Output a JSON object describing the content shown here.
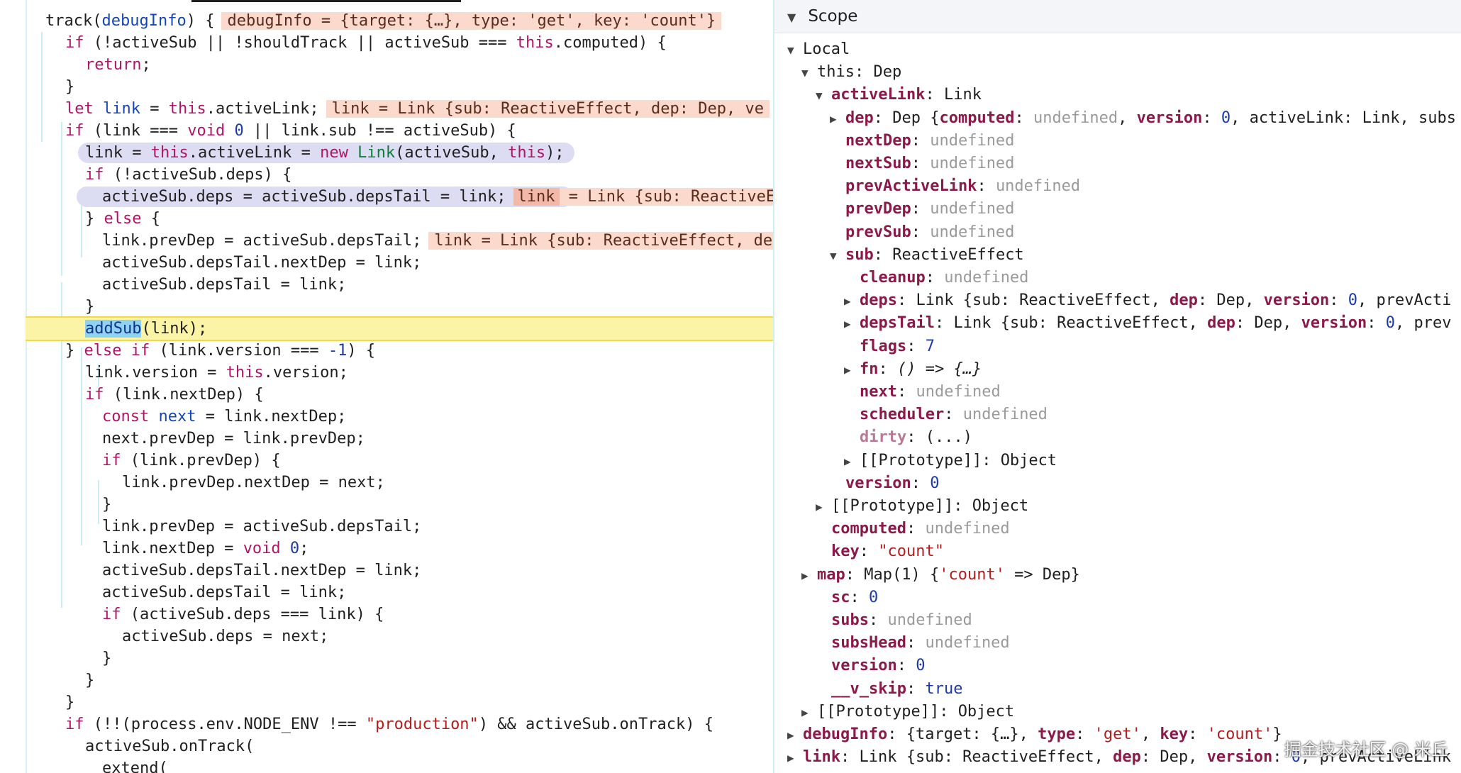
{
  "code": {
    "lines": [
      {
        "id": "l1",
        "segs": [
          [
            "track(",
            ""
          ],
          [
            "debugInfo",
            "fn-name"
          ],
          [
            ") {",
            ""
          ]
        ],
        "inline": "debugInfo = {target: {…}, type: 'get', key: 'count'}"
      },
      {
        "id": "l2",
        "segs": [
          [
            "if",
            "kw"
          ],
          [
            " (!activeSub || !shouldTrack || activeSub === ",
            ""
          ],
          [
            "this",
            "kw"
          ],
          [
            ".computed) {",
            ""
          ]
        ]
      },
      {
        "id": "l3",
        "segs": [
          [
            "return",
            "kw"
          ],
          [
            ";",
            ""
          ]
        ]
      },
      {
        "id": "l4",
        "segs": [
          [
            "}",
            ""
          ]
        ]
      },
      {
        "id": "l5",
        "segs": [
          [
            "let",
            "kw"
          ],
          [
            " ",
            ""
          ],
          [
            "link",
            "fn-name"
          ],
          [
            " = ",
            ""
          ],
          [
            "this",
            "kw"
          ],
          [
            ".activeLink;",
            ""
          ]
        ],
        "inline": "link = Link {sub: ReactiveEffect, dep: Dep, ve"
      },
      {
        "id": "l6",
        "segs": [
          [
            "if",
            "kw"
          ],
          [
            " (link === ",
            ""
          ],
          [
            "void",
            "kw"
          ],
          [
            " ",
            ""
          ],
          [
            "0",
            "num"
          ],
          [
            " || link.sub !== activeSub) {",
            ""
          ]
        ]
      },
      {
        "id": "l7",
        "segs": [
          [
            "link = ",
            ""
          ],
          [
            "this",
            "kw"
          ],
          [
            ".activeLink = ",
            ""
          ],
          [
            "new",
            "kw"
          ],
          [
            " ",
            ""
          ],
          [
            "Link",
            "cls"
          ],
          [
            "(activeSub, ",
            ""
          ],
          [
            "this",
            "kw"
          ],
          [
            ");",
            ""
          ]
        ]
      },
      {
        "id": "l8",
        "segs": [
          [
            "if",
            "kw"
          ],
          [
            " (!activeSub.deps) {",
            ""
          ]
        ]
      },
      {
        "id": "l9",
        "segs": [
          [
            "activeSub.deps = activeSub.depsTail = link;",
            ""
          ]
        ],
        "inline": "link = Link {sub: ReactiveE",
        "inline_dark": "link"
      },
      {
        "id": "l10",
        "segs": [
          [
            "} ",
            ""
          ],
          [
            "else",
            "kw"
          ],
          [
            " {",
            ""
          ]
        ]
      },
      {
        "id": "l11",
        "segs": [
          [
            "link.prevDep = activeSub.depsTail;",
            ""
          ]
        ],
        "inline": "link = Link {sub: ReactiveEffect, de"
      },
      {
        "id": "l12",
        "segs": [
          [
            "activeSub.depsTail.nextDep = link;",
            ""
          ]
        ]
      },
      {
        "id": "l13",
        "segs": [
          [
            "activeSub.depsTail = link;",
            ""
          ]
        ]
      },
      {
        "id": "l14",
        "segs": [
          [
            "}",
            ""
          ]
        ]
      },
      {
        "id": "l15",
        "segs": [
          [
            "addSub",
            "addsub"
          ],
          [
            "(link);",
            ""
          ]
        ]
      },
      {
        "id": "l16",
        "segs": [
          [
            "} ",
            ""
          ],
          [
            "else if",
            "kw"
          ],
          [
            " (link.version === ",
            ""
          ],
          [
            "-",
            "num"
          ],
          [
            "1",
            "num"
          ],
          [
            ") {",
            ""
          ]
        ]
      },
      {
        "id": "l17",
        "segs": [
          [
            "link.version = ",
            ""
          ],
          [
            "this",
            "kw"
          ],
          [
            ".version;",
            ""
          ]
        ]
      },
      {
        "id": "l18",
        "segs": [
          [
            "if",
            "kw"
          ],
          [
            " (link.nextDep) {",
            ""
          ]
        ]
      },
      {
        "id": "l19",
        "segs": [
          [
            "const",
            "kw"
          ],
          [
            " ",
            ""
          ],
          [
            "next",
            "fn-name"
          ],
          [
            " = link.nextDep;",
            ""
          ]
        ]
      },
      {
        "id": "l20",
        "segs": [
          [
            "next.prevDep = link.prevDep;",
            ""
          ]
        ]
      },
      {
        "id": "l21",
        "segs": [
          [
            "if",
            "kw"
          ],
          [
            " (link.prevDep) {",
            ""
          ]
        ]
      },
      {
        "id": "l22",
        "segs": [
          [
            "link.prevDep.nextDep = next;",
            ""
          ]
        ]
      },
      {
        "id": "l23",
        "segs": [
          [
            "}",
            ""
          ]
        ]
      },
      {
        "id": "l24",
        "segs": [
          [
            "link.prevDep = activeSub.depsTail;",
            ""
          ]
        ]
      },
      {
        "id": "l25",
        "segs": [
          [
            "link.nextDep = ",
            ""
          ],
          [
            "void",
            "kw"
          ],
          [
            " ",
            ""
          ],
          [
            "0",
            "num"
          ],
          [
            ";",
            ""
          ]
        ]
      },
      {
        "id": "l26",
        "segs": [
          [
            "activeSub.depsTail.nextDep = link;",
            ""
          ]
        ]
      },
      {
        "id": "l27",
        "segs": [
          [
            "activeSub.depsTail = link;",
            ""
          ]
        ]
      },
      {
        "id": "l28",
        "segs": [
          [
            "if",
            "kw"
          ],
          [
            " (activeSub.deps === link) {",
            ""
          ]
        ]
      },
      {
        "id": "l29",
        "segs": [
          [
            "activeSub.deps = next;",
            ""
          ]
        ]
      },
      {
        "id": "l30",
        "segs": [
          [
            "}",
            ""
          ]
        ]
      },
      {
        "id": "l31",
        "segs": [
          [
            "}",
            ""
          ]
        ]
      },
      {
        "id": "l32",
        "segs": [
          [
            "}",
            ""
          ]
        ]
      },
      {
        "id": "l33",
        "segs": [
          [
            "if",
            "kw"
          ],
          [
            " (!!(process.env.NODE_ENV !== ",
            ""
          ],
          [
            "\"production\"",
            "str"
          ],
          [
            ") && activeSub.onTrack) {",
            ""
          ]
        ]
      },
      {
        "id": "l34",
        "segs": [
          [
            "activeSub.onTrack(",
            ""
          ]
        ]
      },
      {
        "id": "l35",
        "segs": [
          [
            "extend(",
            ""
          ]
        ]
      }
    ]
  },
  "scope": {
    "header": "Scope",
    "rows": [
      {
        "t": "open",
        "k": "Local",
        "style": "plain"
      },
      {
        "t": "open",
        "k": "this",
        "sep": ": ",
        "v": [
          [
            "Dep",
            ""
          ]
        ],
        "style": "plain"
      },
      {
        "t": "open",
        "k": "activeLink",
        "sep": ": ",
        "v": [
          [
            "Link",
            ""
          ]
        ]
      },
      {
        "t": "closed",
        "k": "dep",
        "sep": ": ",
        "v": [
          [
            "Dep {",
            ""
          ],
          [
            "computed",
            "k"
          ],
          [
            ": ",
            ""
          ],
          [
            "undefined",
            "undef"
          ],
          [
            ", ",
            ""
          ],
          [
            "version",
            "k"
          ],
          [
            ": ",
            ""
          ],
          [
            "0",
            "sval-num"
          ],
          [
            ", activeLink: Link, subs",
            ""
          ]
        ]
      },
      {
        "t": "none",
        "k": "nextDep",
        "sep": ": ",
        "v": [
          [
            "undefined",
            "undef"
          ]
        ]
      },
      {
        "t": "none",
        "k": "nextSub",
        "sep": ": ",
        "v": [
          [
            "undefined",
            "undef"
          ]
        ]
      },
      {
        "t": "none",
        "k": "prevActiveLink",
        "sep": ": ",
        "v": [
          [
            "undefined",
            "undef"
          ]
        ]
      },
      {
        "t": "none",
        "k": "prevDep",
        "sep": ": ",
        "v": [
          [
            "undefined",
            "undef"
          ]
        ]
      },
      {
        "t": "none",
        "k": "prevSub",
        "sep": ": ",
        "v": [
          [
            "undefined",
            "undef"
          ]
        ]
      },
      {
        "t": "open",
        "k": "sub",
        "sep": ": ",
        "v": [
          [
            "ReactiveEffect",
            ""
          ]
        ]
      },
      {
        "t": "none",
        "k": "cleanup",
        "sep": ": ",
        "v": [
          [
            "undefined",
            "undef"
          ]
        ]
      },
      {
        "t": "closed",
        "k": "deps",
        "sep": ": ",
        "v": [
          [
            "Link {sub: ReactiveEffect, ",
            ""
          ],
          [
            "dep",
            "k"
          ],
          [
            ": Dep, ",
            ""
          ],
          [
            "version",
            "k"
          ],
          [
            ": ",
            ""
          ],
          [
            "0",
            "sval-num"
          ],
          [
            ", prevActi",
            ""
          ]
        ]
      },
      {
        "t": "closed",
        "k": "depsTail",
        "sep": ": ",
        "v": [
          [
            "Link {sub: ReactiveEffect, ",
            ""
          ],
          [
            "dep",
            "k"
          ],
          [
            ": Dep, ",
            ""
          ],
          [
            "version",
            "k"
          ],
          [
            ": ",
            ""
          ],
          [
            "0",
            "sval-num"
          ],
          [
            ", prev",
            ""
          ]
        ]
      },
      {
        "t": "none",
        "k": "flags",
        "sep": ": ",
        "v": [
          [
            "7",
            "sval-num"
          ]
        ]
      },
      {
        "t": "closed",
        "k": "fn",
        "sep": ": ",
        "v": [
          [
            "() => {…}",
            "italic"
          ]
        ]
      },
      {
        "t": "none",
        "k": "next",
        "sep": ": ",
        "v": [
          [
            "undefined",
            "undef"
          ]
        ]
      },
      {
        "t": "none",
        "k": "scheduler",
        "sep": ": ",
        "v": [
          [
            "undefined",
            "undef"
          ]
        ]
      },
      {
        "t": "none",
        "k": "dirty",
        "sep": ": ",
        "v": [
          [
            "(...)",
            ""
          ]
        ],
        "style": "dim"
      },
      {
        "t": "closed",
        "k": "[[Prototype]]",
        "sep": ": ",
        "v": [
          [
            "Object",
            ""
          ]
        ],
        "style": "proto"
      },
      {
        "t": "none",
        "k": "version",
        "sep": ": ",
        "v": [
          [
            "0",
            "sval-num"
          ]
        ]
      },
      {
        "t": "closed",
        "k": "[[Prototype]]",
        "sep": ": ",
        "v": [
          [
            "Object",
            ""
          ]
        ],
        "style": "proto"
      },
      {
        "t": "none",
        "k": "computed",
        "sep": ": ",
        "v": [
          [
            "undefined",
            "undef"
          ]
        ]
      },
      {
        "t": "none",
        "k": "key",
        "sep": ": ",
        "v": [
          [
            "\"count\"",
            "sval-str"
          ]
        ]
      },
      {
        "t": "closed",
        "k": "map",
        "sep": ": ",
        "v": [
          [
            "Map(1) {",
            ""
          ],
          [
            "'count'",
            "sval-str"
          ],
          [
            " => Dep}",
            ""
          ]
        ]
      },
      {
        "t": "none",
        "k": "sc",
        "sep": ": ",
        "v": [
          [
            "0",
            "sval-num"
          ]
        ]
      },
      {
        "t": "none",
        "k": "subs",
        "sep": ": ",
        "v": [
          [
            "undefined",
            "undef"
          ]
        ]
      },
      {
        "t": "none",
        "k": "subsHead",
        "sep": ": ",
        "v": [
          [
            "undefined",
            "undef"
          ]
        ]
      },
      {
        "t": "none",
        "k": "version",
        "sep": ": ",
        "v": [
          [
            "0",
            "sval-num"
          ]
        ]
      },
      {
        "t": "none",
        "k": "__v_skip",
        "sep": ": ",
        "v": [
          [
            "true",
            "sval-true"
          ]
        ]
      },
      {
        "t": "closed",
        "k": "[[Prototype]]",
        "sep": ": ",
        "v": [
          [
            "Object",
            ""
          ]
        ],
        "style": "proto"
      },
      {
        "t": "closed",
        "k": "debugInfo",
        "sep": ": ",
        "v": [
          [
            "{target: {…}, ",
            ""
          ],
          [
            "type",
            "k"
          ],
          [
            ": ",
            ""
          ],
          [
            "'get'",
            "sval-str"
          ],
          [
            ", ",
            ""
          ],
          [
            "key",
            "k"
          ],
          [
            ": ",
            ""
          ],
          [
            "'count'",
            "sval-str"
          ],
          [
            "}",
            ""
          ]
        ]
      },
      {
        "t": "closed",
        "k": "link",
        "sep": ": ",
        "v": [
          [
            "Link {sub: ReactiveEffect, ",
            ""
          ],
          [
            "dep",
            "k"
          ],
          [
            ": Dep, ",
            ""
          ],
          [
            "version",
            "k"
          ],
          [
            ": ",
            ""
          ],
          [
            "0",
            "sval-num"
          ],
          [
            ", prevActiveLink",
            ""
          ]
        ]
      }
    ]
  },
  "watermark": "掘金技术社区 @ 米丘"
}
